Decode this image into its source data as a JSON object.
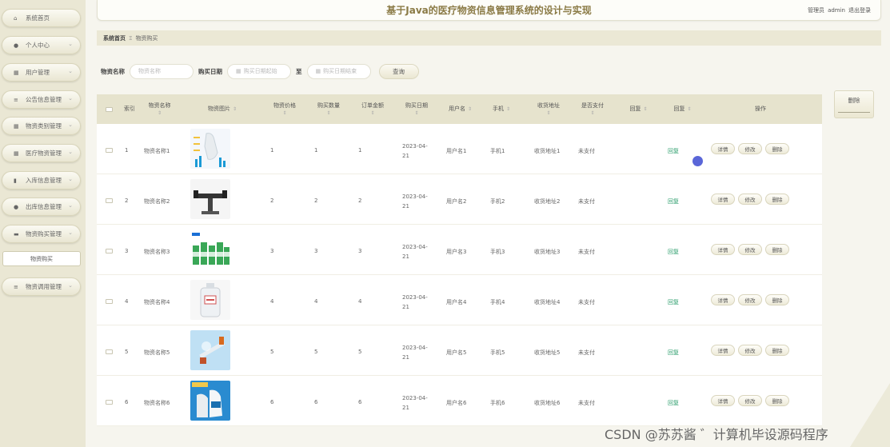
{
  "header": {
    "title": "基于Java的医疗物资信息管理系统的设计与实现",
    "role": "管理员",
    "username": "admin",
    "logout": "退出登录"
  },
  "sidebar": {
    "items": [
      {
        "label": "系统首页",
        "icon": "home-icon"
      },
      {
        "label": "个人中心",
        "icon": "user-icon"
      },
      {
        "label": "用户管理",
        "icon": "grid-icon"
      },
      {
        "label": "公告信息管理",
        "icon": "list-icon"
      },
      {
        "label": "物资类别管理",
        "icon": "grid-icon"
      },
      {
        "label": "医疗物资管理",
        "icon": "grid-icon"
      },
      {
        "label": "入库信息管理",
        "icon": "doc-icon"
      },
      {
        "label": "出库信息管理",
        "icon": "bulb-icon"
      },
      {
        "label": "物资购买管理",
        "icon": "box-icon"
      },
      {
        "label": "物资调用管理",
        "icon": "list-icon"
      }
    ],
    "active_sub": "物资购买"
  },
  "breadcrumb": {
    "home": "系统首页",
    "separator": "Ξ",
    "current": "物资购买"
  },
  "search": {
    "name_label": "物资名称",
    "name_placeholder": "物资名称",
    "date_label": "购买日期",
    "date_start_placeholder": "购买日期起始",
    "to": "至",
    "date_end_placeholder": "购买日期结束",
    "query_button": "查询"
  },
  "bulk_delete": "删除",
  "table": {
    "headers": [
      "索引",
      "物资名称",
      "物资图片",
      "物资价格",
      "购买数量",
      "订单金额",
      "购买日期",
      "用户名",
      "手机",
      "收货地址",
      "是否支付",
      "回复",
      "回复",
      "操作"
    ],
    "rows": [
      {
        "idx": "1",
        "name": "物资名称1",
        "price": "1",
        "qty": "1",
        "amount": "1",
        "date": "2023-04-21",
        "user": "用户名1",
        "phone": "手机1",
        "addr": "收货地址1",
        "paid": "未支付",
        "reply": "回复"
      },
      {
        "idx": "2",
        "name": "物资名称2",
        "price": "2",
        "qty": "2",
        "amount": "2",
        "date": "2023-04-21",
        "user": "用户名2",
        "phone": "手机2",
        "addr": "收货地址2",
        "paid": "未支付",
        "reply": "回复"
      },
      {
        "idx": "3",
        "name": "物资名称3",
        "price": "3",
        "qty": "3",
        "amount": "3",
        "date": "2023-04-21",
        "user": "用户名3",
        "phone": "手机3",
        "addr": "收货地址3",
        "paid": "未支付",
        "reply": "回复"
      },
      {
        "idx": "4",
        "name": "物资名称4",
        "price": "4",
        "qty": "4",
        "amount": "4",
        "date": "2023-04-21",
        "user": "用户名4",
        "phone": "手机4",
        "addr": "收货地址4",
        "paid": "未支付",
        "reply": "回复"
      },
      {
        "idx": "5",
        "name": "物资名称5",
        "price": "5",
        "qty": "5",
        "amount": "5",
        "date": "2023-04-21",
        "user": "用户名5",
        "phone": "手机5",
        "addr": "收货地址5",
        "paid": "未支付",
        "reply": "回复"
      },
      {
        "idx": "6",
        "name": "物资名称6",
        "price": "6",
        "qty": "6",
        "amount": "6",
        "date": "2023-04-21",
        "user": "用户名6",
        "phone": "手机6",
        "addr": "收货地址6",
        "paid": "未支付",
        "reply": "回复"
      }
    ],
    "ops": [
      "详情",
      "修改",
      "删除"
    ]
  },
  "watermark": "CSDN @苏苏酱 ゛计算机毕设源码程序"
}
